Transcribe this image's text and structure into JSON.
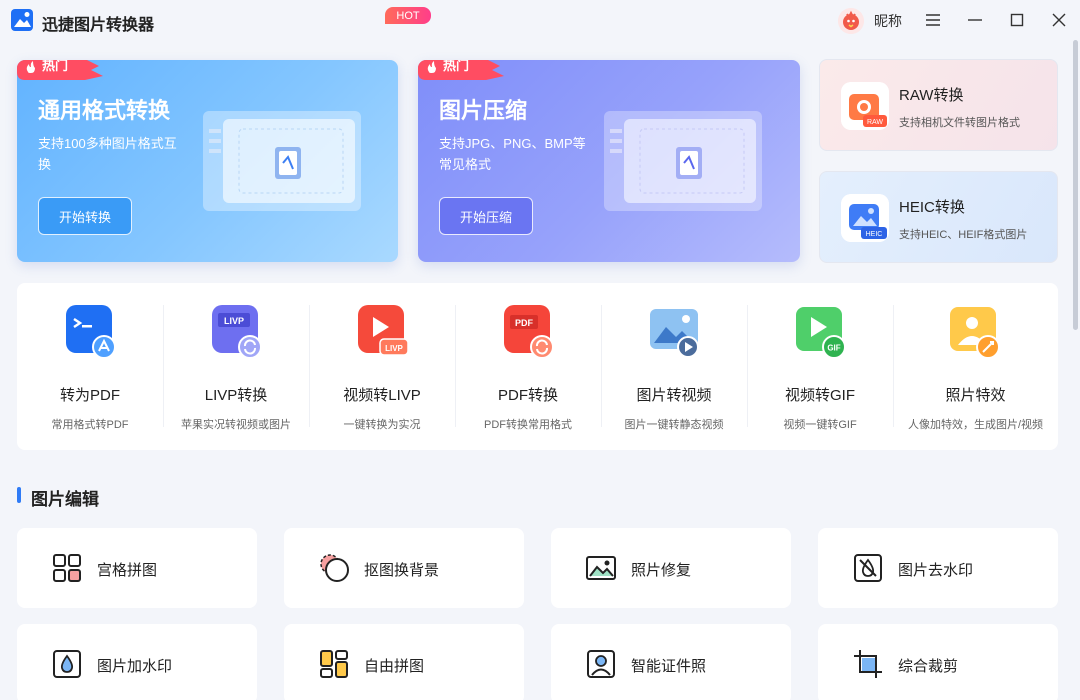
{
  "app": {
    "title": "迅捷图片转换器"
  },
  "user": {
    "name": "昵称"
  },
  "hero_cards": [
    {
      "tag": "热门",
      "title": "通用格式转换",
      "desc": "支持100多种图片格式互换",
      "button": "开始转换"
    },
    {
      "tag": "热门",
      "title": "图片压缩",
      "desc": "支持JPG、PNG、BMP等常见格式",
      "button": "开始压缩"
    }
  ],
  "side_cards": [
    {
      "title": "RAW转换",
      "desc": "支持相机文件转图片格式",
      "badge": "RAW"
    },
    {
      "title": "HEIC转换",
      "desc": "支持HEIC、HEIF格式图片",
      "badge": "HEIC"
    }
  ],
  "tools": [
    {
      "name": "转为PDF",
      "desc": "常用格式转PDF"
    },
    {
      "name": "LIVP转换",
      "desc": "苹果实况转视频或图片",
      "badge": "LIVP"
    },
    {
      "name": "视频转LIVP",
      "desc": "一键转换为实况",
      "badge": "LIVP"
    },
    {
      "name": "PDF转换",
      "desc": "PDF转换常用格式",
      "badge": "PDF"
    },
    {
      "name": "图片转视频",
      "desc": "图片一键转静态视频"
    },
    {
      "name": "视频转GIF",
      "desc": "视频一键转GIF",
      "badge": "GIF"
    },
    {
      "name": "照片特效",
      "desc": "人像加特效，生成图片/视频"
    }
  ],
  "hot_tag": "HOT",
  "section": {
    "title": "图片编辑"
  },
  "edit_tools": [
    {
      "label": "宫格拼图"
    },
    {
      "label": "抠图换背景"
    },
    {
      "label": "照片修复"
    },
    {
      "label": "图片去水印"
    },
    {
      "label": "图片加水印"
    },
    {
      "label": "自由拼图"
    },
    {
      "label": "智能证件照"
    },
    {
      "label": "综合裁剪"
    }
  ],
  "colors": {
    "accent": "#2f7bf6",
    "hero1": "#62b3ff",
    "hero2": "#7f8ef9",
    "hot": "#ff4d4f"
  }
}
